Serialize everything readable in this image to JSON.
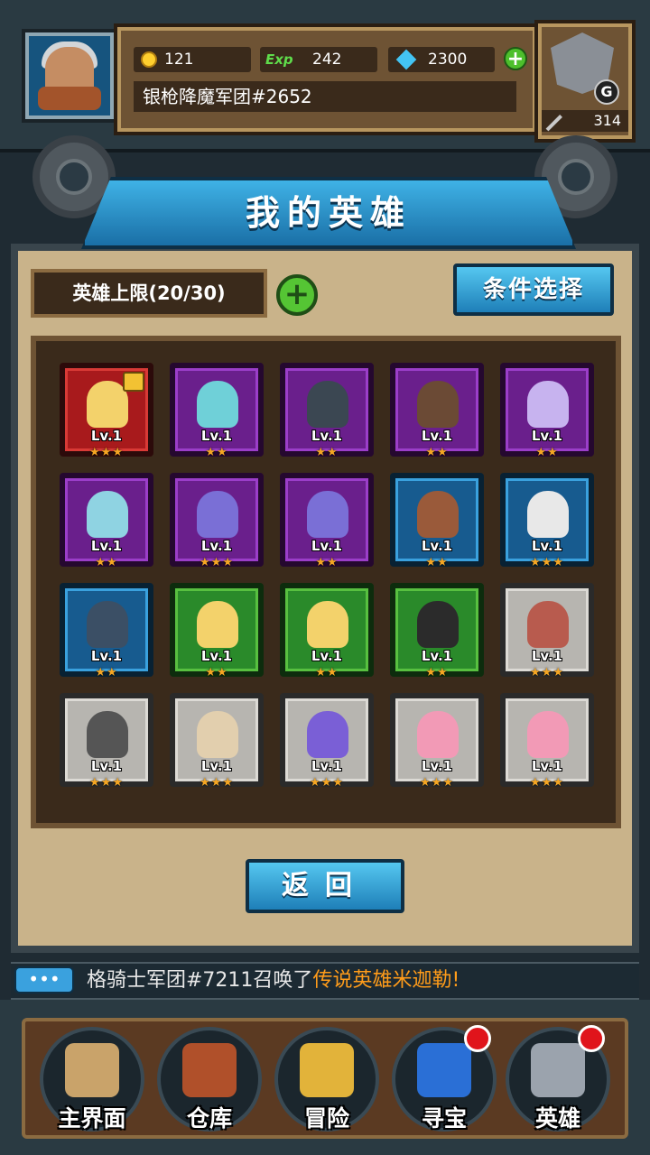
{
  "header": {
    "gold": "121",
    "exp_label": "Exp",
    "exp": "242",
    "gems": "2300",
    "legion_name": "银枪降魔军团#2652",
    "rank_letter": "G",
    "power": "314"
  },
  "page": {
    "title": "我的英雄",
    "hero_limit": "英雄上限(20/30)",
    "filter_button": "条件选择",
    "back_button": "返回"
  },
  "heroes": [
    {
      "level": "Lv.1",
      "stars": "★★★",
      "frame": "red"
    },
    {
      "level": "Lv.1",
      "stars": "★★",
      "frame": "purple"
    },
    {
      "level": "Lv.1",
      "stars": "★★",
      "frame": "purple"
    },
    {
      "level": "Lv.1",
      "stars": "★★",
      "frame": "purple"
    },
    {
      "level": "Lv.1",
      "stars": "★★",
      "frame": "purple"
    },
    {
      "level": "Lv.1",
      "stars": "★★",
      "frame": "purple"
    },
    {
      "level": "Lv.1",
      "stars": "★★★",
      "frame": "purple"
    },
    {
      "level": "Lv.1",
      "stars": "★★",
      "frame": "purple"
    },
    {
      "level": "Lv.1",
      "stars": "★★",
      "frame": "blue"
    },
    {
      "level": "Lv.1",
      "stars": "★★★",
      "frame": "blue"
    },
    {
      "level": "Lv.1",
      "stars": "★★",
      "frame": "blue"
    },
    {
      "level": "Lv.1",
      "stars": "★★",
      "frame": "green"
    },
    {
      "level": "Lv.1",
      "stars": "★★",
      "frame": "green"
    },
    {
      "level": "Lv.1",
      "stars": "★★",
      "frame": "green"
    },
    {
      "level": "Lv.1",
      "stars": "★★★",
      "frame": "gray"
    },
    {
      "level": "Lv.1",
      "stars": "★★★",
      "frame": "gray"
    },
    {
      "level": "Lv.1",
      "stars": "★★★",
      "frame": "gray"
    },
    {
      "level": "Lv.1",
      "stars": "★★★",
      "frame": "gray"
    },
    {
      "level": "Lv.1",
      "stars": "★★★",
      "frame": "gray"
    },
    {
      "level": "Lv.1",
      "stars": "★★★",
      "frame": "gray"
    }
  ],
  "ticker": {
    "prefix": "格骑士军团#7211召唤了",
    "highlight": "传说英雄米迦勒!"
  },
  "nav": [
    {
      "label": "主界面",
      "icon": "scroll-map-icon",
      "badge": false
    },
    {
      "label": "仓库",
      "icon": "treasure-chest-icon",
      "badge": false
    },
    {
      "label": "冒险",
      "icon": "winged-sword-icon",
      "badge": false
    },
    {
      "label": "寻宝",
      "icon": "blue-crystal-icon",
      "badge": true
    },
    {
      "label": "英雄",
      "icon": "knight-helmet-icon",
      "badge": true
    }
  ],
  "colors": {
    "accent_blue": "#3aa1de",
    "highlight_orange": "#ff9c1a",
    "badge_red": "#e0141b"
  }
}
